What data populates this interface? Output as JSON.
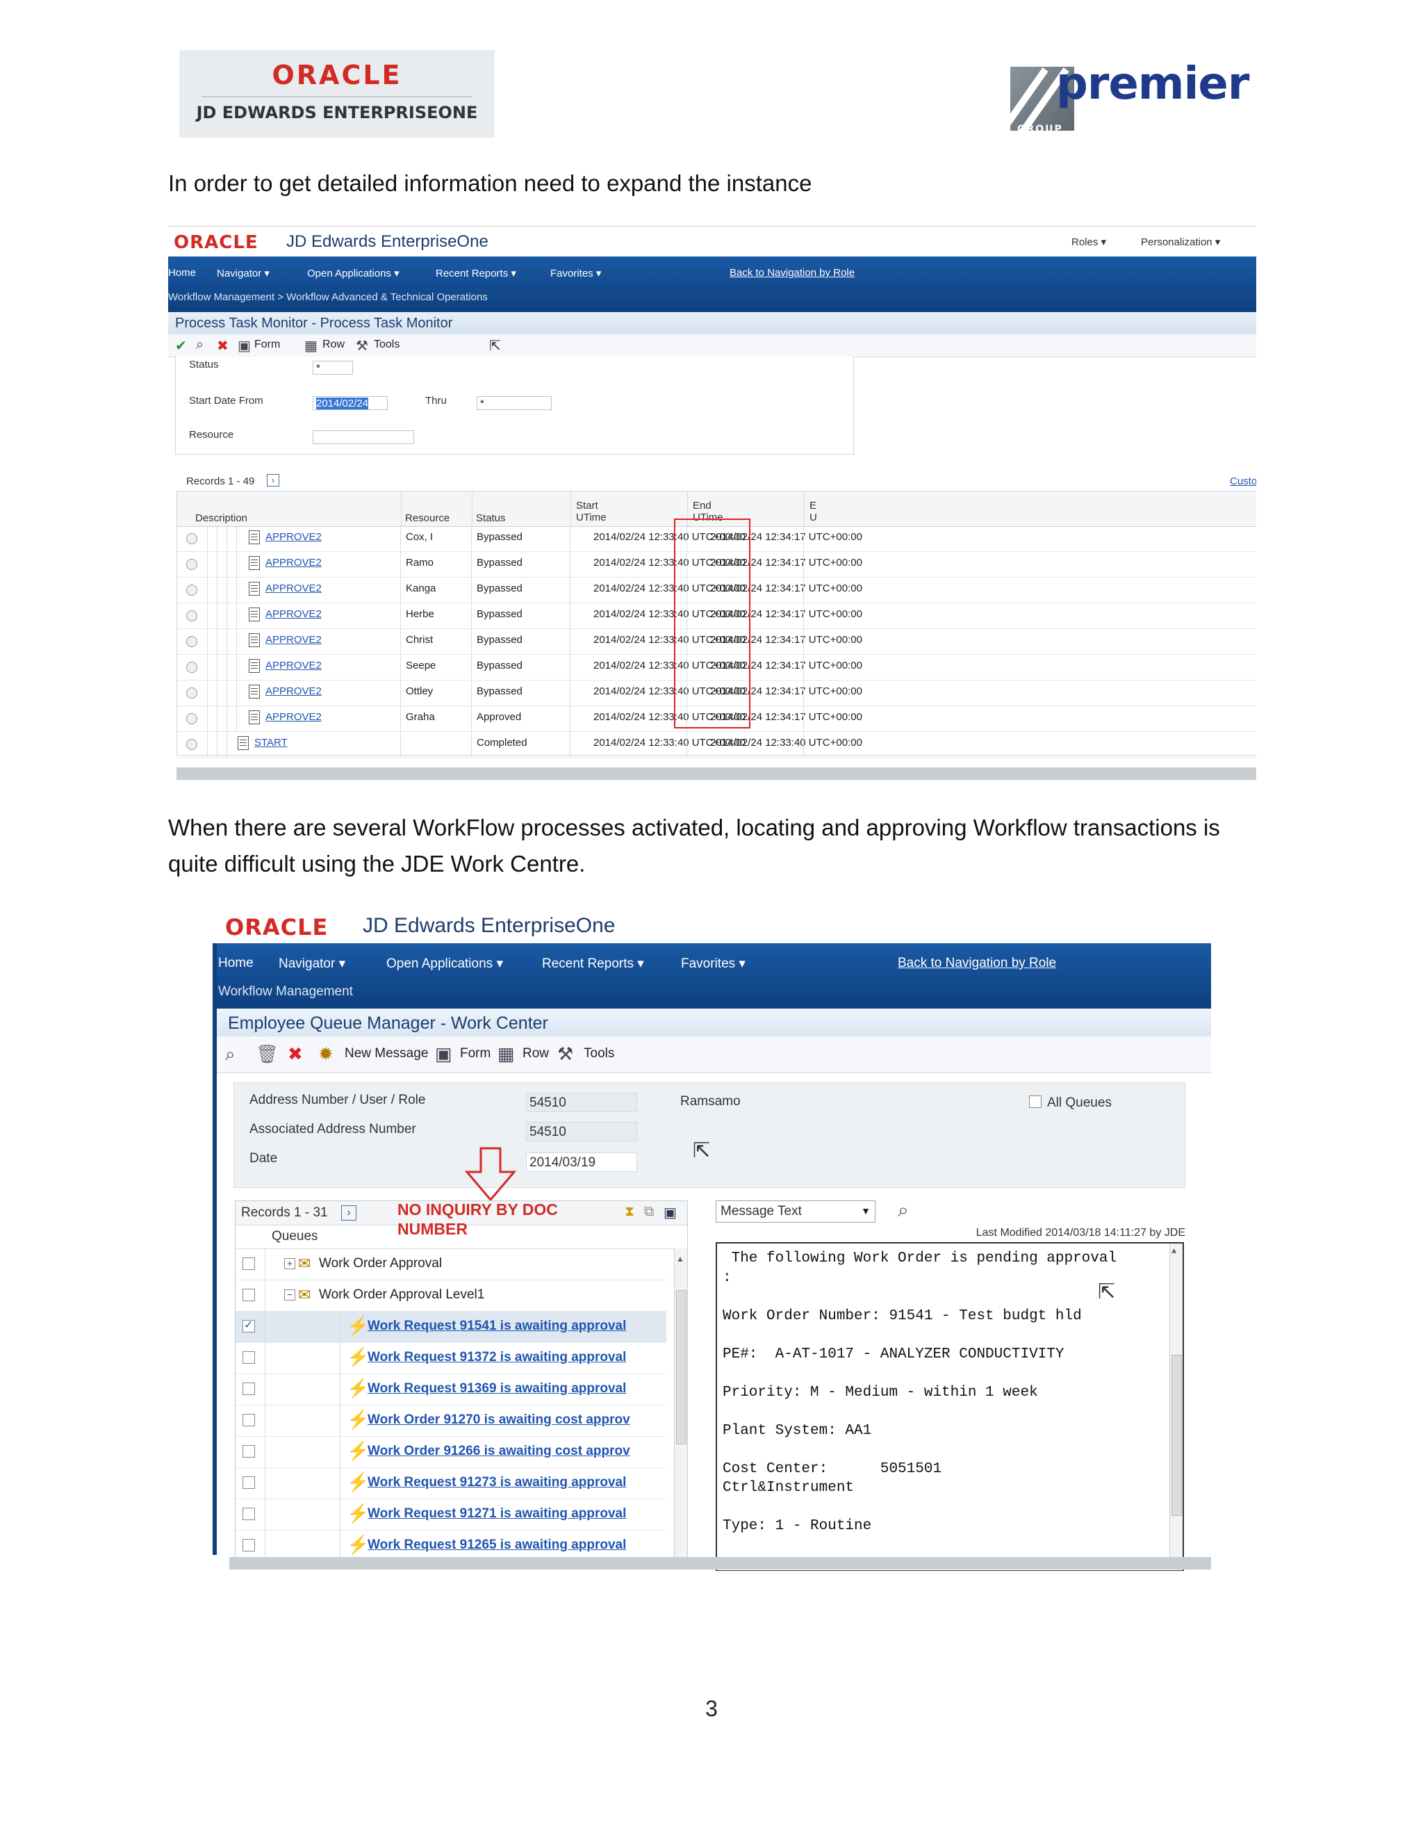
{
  "header": {
    "oracle_logo_word": "ORACLE",
    "oracle_logo_sub": "JD EDWARDS ENTERPRISEONE",
    "premier_logo_word": "premier",
    "premier_logo_group": "GROUP"
  },
  "paragraphs": {
    "p1": "In order to get detailed information need to expand the instance",
    "p2_line1": "When there are several WorkFlow processes activated, locating and approving Workflow transactions is",
    "p2_line2": "quite difficult using the JDE Work Centre."
  },
  "page_number": "3",
  "shot1": {
    "oracle": "ORACLE",
    "product": "JD Edwards EnterpriseOne",
    "roles": "Roles",
    "personalization": "Personalization",
    "nav": [
      "Home",
      "Navigator",
      "Open Applications",
      "Recent Reports",
      "Favorites"
    ],
    "back_link": "Back to Navigation by Role",
    "breadcrumb": "Workflow Management  >  Workflow Advanced & Technical Operations",
    "form_title": "Process Task Monitor - Process Task Monitor",
    "toolbar": {
      "form": "Form",
      "row": "Row",
      "tools": "Tools"
    },
    "filters": {
      "status_label": "Status",
      "status_value": "*",
      "start_label": "Start Date From",
      "start_value": "2014/02/24",
      "thru_label": "Thru",
      "thru_value": "*",
      "resource_label": "Resource",
      "resource_value": ""
    },
    "records": "Records 1 - 49",
    "custom": "Custo",
    "columns": {
      "description": "Description",
      "resource": "Resource",
      "status": "Status",
      "start_top": "Start",
      "start_bottom": "UTime",
      "end_top": "End",
      "end_bottom": "UTime",
      "extra_top": "E",
      "extra_bottom": "U"
    },
    "rows": [
      {
        "desc": "APPROVE2",
        "res": "Cox, I",
        "status": "Bypassed",
        "start": "2014/02/24 12:33:40 UTC+00:00",
        "end": "2014/02/24 12:34:17 UTC+00:00"
      },
      {
        "desc": "APPROVE2",
        "res": "Ramo",
        "status": "Bypassed",
        "start": "2014/02/24 12:33:40 UTC+00:00",
        "end": "2014/02/24 12:34:17 UTC+00:00"
      },
      {
        "desc": "APPROVE2",
        "res": "Kanga",
        "status": "Bypassed",
        "start": "2014/02/24 12:33:40 UTC+00:00",
        "end": "2014/02/24 12:34:17 UTC+00:00"
      },
      {
        "desc": "APPROVE2",
        "res": "Herbe",
        "status": "Bypassed",
        "start": "2014/02/24 12:33:40 UTC+00:00",
        "end": "2014/02/24 12:34:17 UTC+00:00"
      },
      {
        "desc": "APPROVE2",
        "res": "Christ",
        "status": "Bypassed",
        "start": "2014/02/24 12:33:40 UTC+00:00",
        "end": "2014/02/24 12:34:17 UTC+00:00"
      },
      {
        "desc": "APPROVE2",
        "res": "Seepe",
        "status": "Bypassed",
        "start": "2014/02/24 12:33:40 UTC+00:00",
        "end": "2014/02/24 12:34:17 UTC+00:00"
      },
      {
        "desc": "APPROVE2",
        "res": "Ottley",
        "status": "Bypassed",
        "start": "2014/02/24 12:33:40 UTC+00:00",
        "end": "2014/02/24 12:34:17 UTC+00:00"
      },
      {
        "desc": "APPROVE2",
        "res": "Graha",
        "status": "Approved",
        "start": "2014/02/24 12:33:40 UTC+00:00",
        "end": "2014/02/24 12:34:17 UTC+00:00"
      },
      {
        "desc": "START",
        "res": "",
        "status": "Completed",
        "start": "2014/02/24 12:33:40 UTC+00:00",
        "end": "2014/02/24 12:33:40 UTC+00:00"
      }
    ]
  },
  "shot2": {
    "oracle": "ORACLE",
    "product": "JD Edwards EnterpriseOne",
    "nav": [
      "Home",
      "Navigator",
      "Open Applications",
      "Recent Reports",
      "Favorites"
    ],
    "back_link": "Back to Navigation by Role",
    "breadcrumb": "Workflow Management",
    "form_title": "Employee Queue Manager - Work Center",
    "toolbar": {
      "new_message": "New Message",
      "form": "Form",
      "row": "Row",
      "tools": "Tools"
    },
    "filters": {
      "addr_label": "Address Number / User / Role",
      "addr_value": "54510",
      "addr_name": "Ramsamo",
      "assoc_label": "Associated Address Number",
      "assoc_value": "54510",
      "date_label": "Date",
      "date_value": "2014/03/19",
      "all_queues": "All Queues"
    },
    "records": "Records 1 - 31",
    "annotation_line1": "NO INQUIRY BY DOC",
    "annotation_line2": "NUMBER",
    "queues_header": "Queues",
    "queues": [
      {
        "label": "Work Order Approval",
        "type": "folder",
        "checked": false
      },
      {
        "label": "Work Order Approval Level1",
        "type": "folder",
        "checked": false
      },
      {
        "label": "Work Request 91541 is awaiting approval",
        "type": "item",
        "checked": true
      },
      {
        "label": "Work Request 91372 is awaiting approval",
        "type": "item",
        "checked": false
      },
      {
        "label": "Work Request 91369 is awaiting approval",
        "type": "item",
        "checked": false
      },
      {
        "label": "Work Order 91270 is awaiting cost approv",
        "type": "item",
        "checked": false
      },
      {
        "label": "Work Order 91266 is awaiting cost approv",
        "type": "item",
        "checked": false
      },
      {
        "label": "Work Request 91273 is awaiting approval",
        "type": "item",
        "checked": false
      },
      {
        "label": "Work Request 91271 is awaiting approval",
        "type": "item",
        "checked": false
      },
      {
        "label": "Work Request 91265 is awaiting approval",
        "type": "item",
        "checked": false
      }
    ],
    "message_select": "Message Text",
    "last_modified": "Last Modified 2014/03/18 14:11:27 by JDE",
    "message_lines": [
      " The following Work Order is pending approval",
      ":",
      "",
      "Work Order Number: 91541 - Test budgt hld",
      "",
      "PE#:  A-AT-1017 - ANALYZER CONDUCTIVITY",
      "",
      "Priority: M - Medium - within 1 week",
      "",
      "Plant System: AA1",
      "",
      "Cost Center:      5051501",
      "Ctrl&Instrument",
      "",
      "Type: 1 - Routine"
    ]
  }
}
